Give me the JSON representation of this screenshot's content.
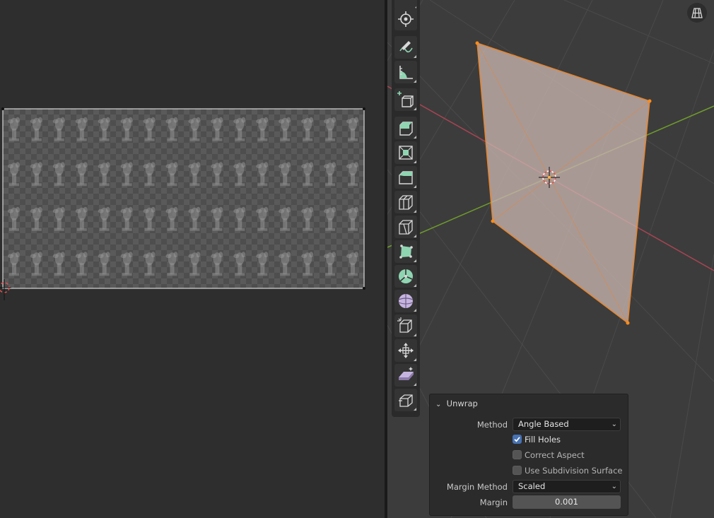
{
  "uv_editor": {
    "background": "#2e2e2e",
    "image_grid": {
      "columns": 16,
      "rows": 4
    }
  },
  "viewport": {
    "background": "#3c3c3c",
    "axis_colors": {
      "x": "#a84452",
      "y": "#6f9b2c"
    },
    "selection_color": "#e8852a",
    "toolbar": {
      "tools": [
        {
          "name": "cursor-tool",
          "icon": "cursor-icon"
        },
        {
          "name": "annotate-tool",
          "icon": "annotate-icon"
        },
        {
          "name": "measure-tool",
          "icon": "ruler-icon"
        },
        {
          "name": "add-cube-tool",
          "icon": "add-cube-icon"
        },
        {
          "name": "extrude-tool",
          "icon": "extrude-icon"
        },
        {
          "name": "inset-tool",
          "icon": "inset-icon"
        },
        {
          "name": "bevel-tool",
          "icon": "bevel-icon"
        },
        {
          "name": "loop-cut-tool",
          "icon": "loop-cut-icon"
        },
        {
          "name": "knife-tool",
          "icon": "knife-icon"
        },
        {
          "name": "poly-build-tool",
          "icon": "poly-build-icon"
        },
        {
          "name": "spin-tool",
          "icon": "spin-icon"
        },
        {
          "name": "smooth-tool",
          "icon": "smooth-icon"
        },
        {
          "name": "edge-slide-tool",
          "icon": "edge-slide-icon"
        },
        {
          "name": "shrink-fatten-tool",
          "icon": "shrink-fatten-icon"
        },
        {
          "name": "shear-tool",
          "icon": "shear-icon"
        },
        {
          "name": "rip-region-tool",
          "icon": "rip-region-icon"
        }
      ]
    },
    "perspective_toggle_icon": "perspective-grid-icon"
  },
  "operator_panel": {
    "title": "Unwrap",
    "method_label": "Method",
    "method_value": "Angle Based",
    "fill_holes_label": "Fill Holes",
    "fill_holes_checked": true,
    "correct_aspect_label": "Correct Aspect",
    "correct_aspect_checked": false,
    "use_subdivision_label": "Use Subdivision Surface",
    "use_subdivision_checked": false,
    "margin_method_label": "Margin Method",
    "margin_method_value": "Scaled",
    "margin_label": "Margin",
    "margin_value": "0.001"
  }
}
